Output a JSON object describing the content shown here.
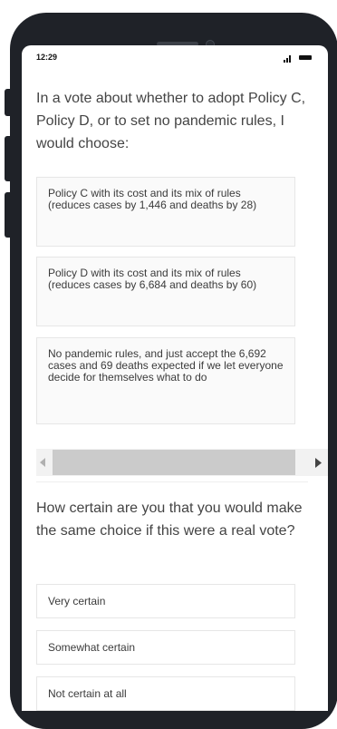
{
  "status_bar": {
    "time": "12:29"
  },
  "question1": {
    "prompt": "In a vote about whether to adopt Policy C, Policy D, or to set no pandemic rules, I would choose:",
    "options": [
      "Policy C with its cost and its mix of rules (reduces cases by 1,446 and deaths by 28)",
      "Policy D with its cost and its mix of rules (reduces cases by 6,684 and deaths by 60)",
      "No pandemic rules, and just accept the 6,692 cases and 69 deaths expected if we let everyone decide for themselves what to do"
    ]
  },
  "question2": {
    "prompt": "How certain are you that you would make the same choice if this were a real vote?",
    "options": [
      "Very certain",
      "Somewhat certain",
      "Not certain at all"
    ]
  },
  "colors": {
    "frame": "#1f2228",
    "text": "#444444",
    "option_border": "#e6e6e6"
  }
}
